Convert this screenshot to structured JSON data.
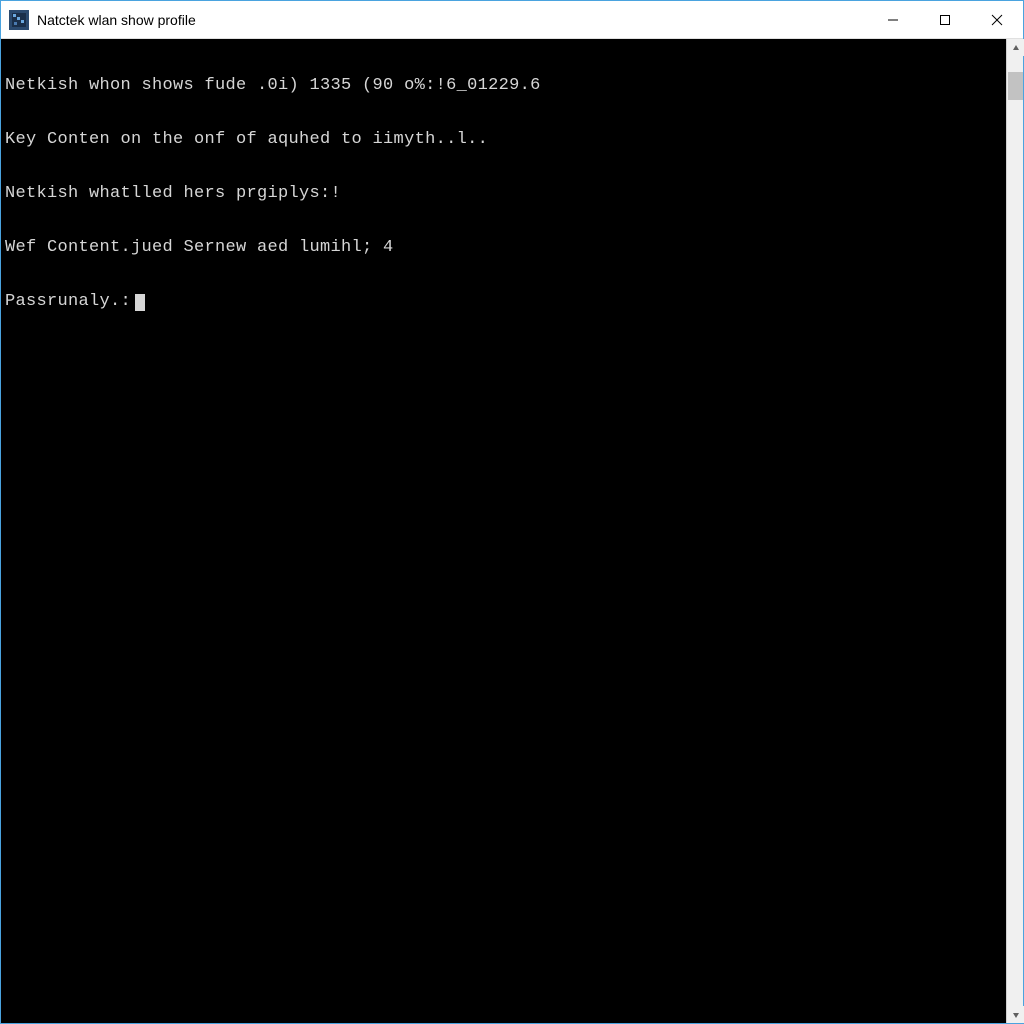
{
  "window": {
    "title": "Natctek wlan show profile"
  },
  "terminal": {
    "lines": [
      "Netkish whon shows fude .0i) 1335 (90 o%:!6_01229.6",
      "Key Conten on the onf of aquhed to iimyth..l..",
      "Netkish whatlled hers prgiplys:!",
      "Wef Content.jued Sernew aed lumihl; 4"
    ],
    "prompt": "Passrunaly.:"
  }
}
